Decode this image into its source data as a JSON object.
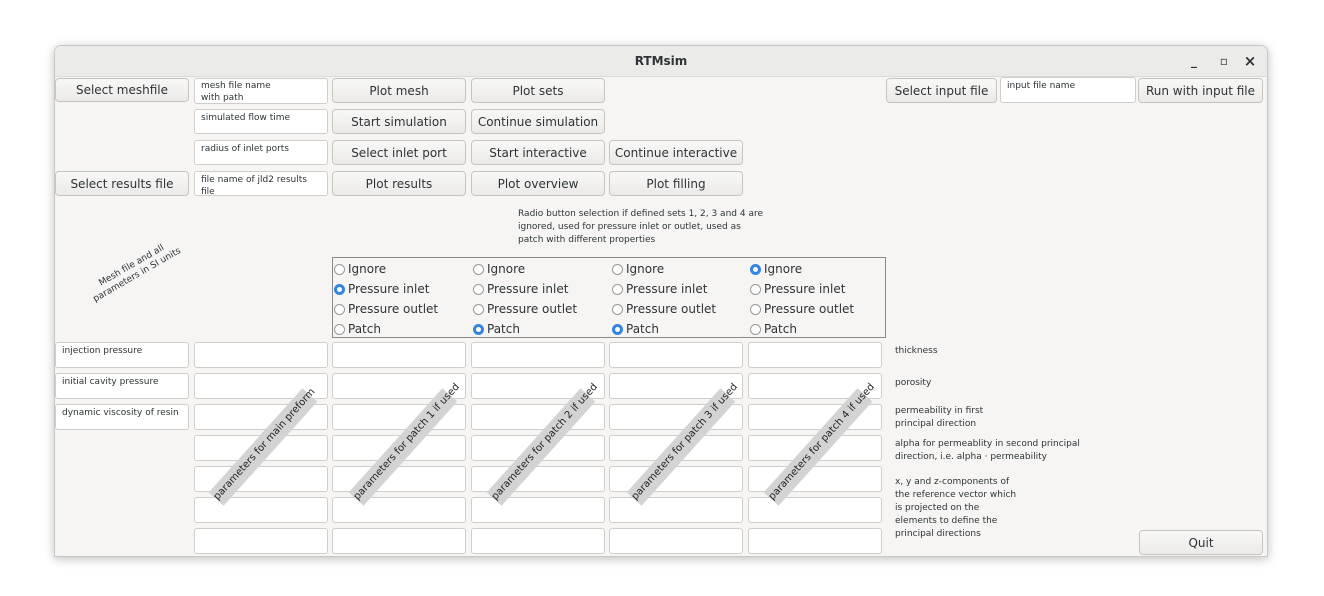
{
  "window": {
    "title": "RTMsim",
    "minimize": "_",
    "maximize": "▫",
    "close": "×"
  },
  "row1": {
    "select_meshfile": "Select meshfile",
    "mesh_field": "mesh file name\nwith path",
    "plot_mesh": "Plot mesh",
    "plot_sets": "Plot sets",
    "select_input_file": "Select input file",
    "input_field": "input file name",
    "run_with_input": "Run with input file"
  },
  "row2": {
    "time_field": "simulated flow time",
    "start_simulation": "Start simulation",
    "continue_simulation": "Continue simulation"
  },
  "row3": {
    "radius_field": "radius of inlet ports",
    "select_inlet_port": "Select inlet port",
    "start_interactive": "Start interactive",
    "continue_interactive": "Continue interactive"
  },
  "row4": {
    "select_results_file": "Select results file",
    "results_field": "file name of jld2 results file",
    "plot_results": "Plot results",
    "plot_overview": "Plot overview",
    "plot_filling": "Plot filling"
  },
  "radio_note": "Radio button selection if defined sets 1, 2, 3 and 4 are ignored, used for pressure inlet or outlet, used as patch with different properties",
  "units_note": "Mesh file and all\nparameters in SI units",
  "radio_groups": [
    {
      "options": [
        "Ignore",
        "Pressure inlet",
        "Pressure outlet",
        "Patch"
      ],
      "selected": "Pressure inlet"
    },
    {
      "options": [
        "Ignore",
        "Pressure inlet",
        "Pressure outlet",
        "Patch"
      ],
      "selected": "Patch"
    },
    {
      "options": [
        "Ignore",
        "Pressure inlet",
        "Pressure outlet",
        "Patch"
      ],
      "selected": "Patch"
    },
    {
      "options": [
        "Ignore",
        "Pressure inlet",
        "Pressure outlet",
        "Patch"
      ],
      "selected": "Ignore"
    }
  ],
  "left_params": [
    "injection pressure",
    "initial cavity pressure",
    "dynamic viscosity of resin"
  ],
  "right_labels": [
    "thickness",
    "porosity",
    "permeability in first\nprincipal direction",
    "alpha for permeablity in second principal\ndirection, i.e. alpha · permeability",
    "x, y and z-components of\nthe reference vector which\nis projected on the\nelements to define the\nprincipal directions"
  ],
  "stamps": [
    "parameters for main preform",
    "parameters for patch 1 if used",
    "parameters for patch 2 if used",
    "parameters for patch 3 if used",
    "parameters for patch 4 if used"
  ],
  "quit": "Quit",
  "colors": {
    "accent": "#3584e4",
    "window_bg": "#f6f5f4",
    "titlebar_bg": "#ebebea"
  }
}
